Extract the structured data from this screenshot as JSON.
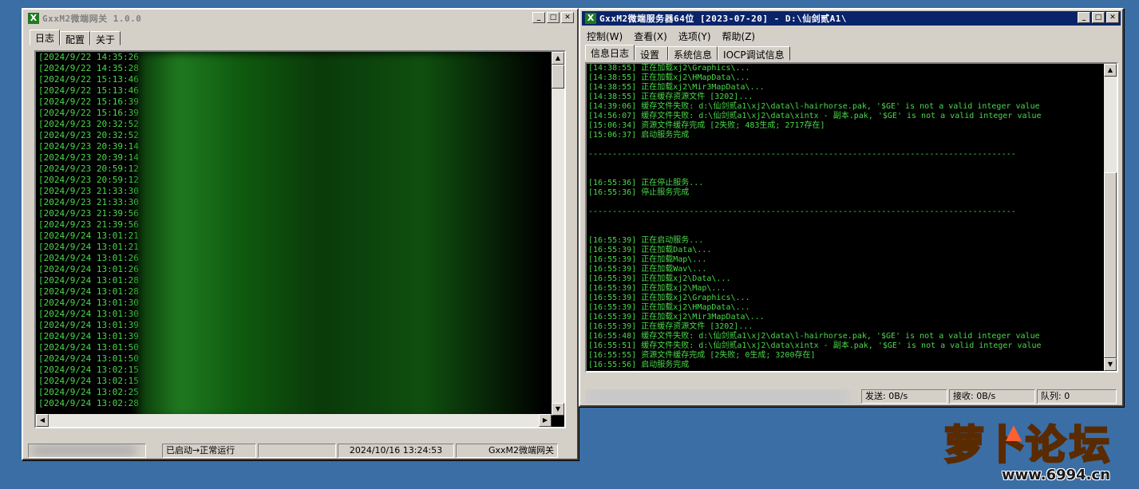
{
  "left_window": {
    "title": "GxxM2微端网关 1.0.0",
    "tabs": [
      "日志",
      "配置",
      "关于"
    ],
    "log_lines": [
      "[2024/9/22 14:35:26",
      "[2024/9/22 14:35:28",
      "[2024/9/22 15:13:46",
      "[2024/9/22 15:13:46",
      "[2024/9/22 15:16:39",
      "[2024/9/22 15:16:39",
      "[2024/9/23 20:32:52",
      "[2024/9/23 20:32:52",
      "[2024/9/23 20:39:14",
      "[2024/9/23 20:39:14",
      "[2024/9/23 20:59:12",
      "[2024/9/23 20:59:12",
      "[2024/9/23 21:33:30",
      "[2024/9/23 21:33:30",
      "[2024/9/23 21:39:56",
      "[2024/9/23 21:39:56",
      "[2024/9/24 13:01:21",
      "[2024/9/24 13:01:21",
      "[2024/9/24 13:01:26",
      "[2024/9/24 13:01:26",
      "[2024/9/24 13:01:28",
      "[2024/9/24 13:01:28",
      "[2024/9/24 13:01:30",
      "[2024/9/24 13:01:30",
      "[2024/9/24 13:01:39",
      "[2024/9/24 13:01:39",
      "[2024/9/24 13:01:50",
      "[2024/9/24 13:01:50",
      "[2024/9/24 13:02:15",
      "[2024/9/24 13:02:15",
      "[2024/9/24 13:02:25",
      "[2024/9/24 13:02:28"
    ],
    "status": {
      "state": "已启动→正常运行",
      "datetime": "2024/10/16 13:24:53",
      "app_name": "GxxM2微端网关"
    }
  },
  "right_window": {
    "title": "GxxM2微端服务器64位 [2023-07-20] - D:\\仙剑贰A1\\",
    "menu": [
      "控制(W)",
      "查看(X)",
      "选项(Y)",
      "帮助(Z)"
    ],
    "tabs": [
      "信息日志",
      "设置",
      "系统信息",
      "IOCP调试信息"
    ],
    "log_lines": [
      "[14:38:55] 正在加载xj2\\Graphics\\...",
      "[14:38:55] 正在加载xj2\\HMapData\\...",
      "[14:38:55] 正在加载xj2\\Mir3MapData\\...",
      "[14:38:55] 正在缓存资源文件 [3202]...",
      "[14:39:06] 缓存文件失败: d:\\仙剑贰a1\\xj2\\data\\l-hairhorse.pak, '$GE' is not a valid integer value",
      "[14:56:07] 缓存文件失败: d:\\仙剑贰a1\\xj2\\data\\xintx - 副本.pak, '$GE' is not a valid integer value",
      "[15:06:34] 资源文件缓存完成 [2失败; 483生成; 2717存在]",
      "[15:06:37] 启动服务完成",
      "",
      "-----------------------------------------------------------------------------------------",
      "",
      "",
      "[16:55:36] 正在停止服务...",
      "[16:55:36] 停止服务完成",
      "",
      "-----------------------------------------------------------------------------------------",
      "",
      "",
      "[16:55:39] 正在启动服务...",
      "[16:55:39] 正在加载Data\\...",
      "[16:55:39] 正在加载Map\\...",
      "[16:55:39] 正在加载Wav\\...",
      "[16:55:39] 正在加载xj2\\Data\\...",
      "[16:55:39] 正在加载xj2\\Map\\...",
      "[16:55:39] 正在加载xj2\\Graphics\\...",
      "[16:55:39] 正在加载xj2\\HMapData\\...",
      "[16:55:39] 正在加载xj2\\Mir3MapData\\...",
      "[16:55:39] 正在缓存资源文件 [3202]...",
      "[16:55:48] 缓存文件失败: d:\\仙剑贰a1\\xj2\\data\\l-hairhorse.pak, '$GE' is not a valid integer value",
      "[16:55:51] 缓存文件失败: d:\\仙剑贰a1\\xj2\\data\\xintx - 副本.pak, '$GE' is not a valid integer value",
      "[16:55:55] 资源文件缓存完成 [2失败; 0生成; 3200存在]",
      "[16:55:56] 启动服务完成"
    ],
    "status": {
      "send": "发送: 0B/s",
      "recv": "接收: 0B/s",
      "queue": "队列: 0"
    }
  },
  "watermark": {
    "logo_text": "萝卜论坛",
    "url": "www.6994.cn"
  },
  "colors": {
    "desktop": "#3a6ea5",
    "log_text": "#4ad94a",
    "active_title": "#0a246a"
  }
}
